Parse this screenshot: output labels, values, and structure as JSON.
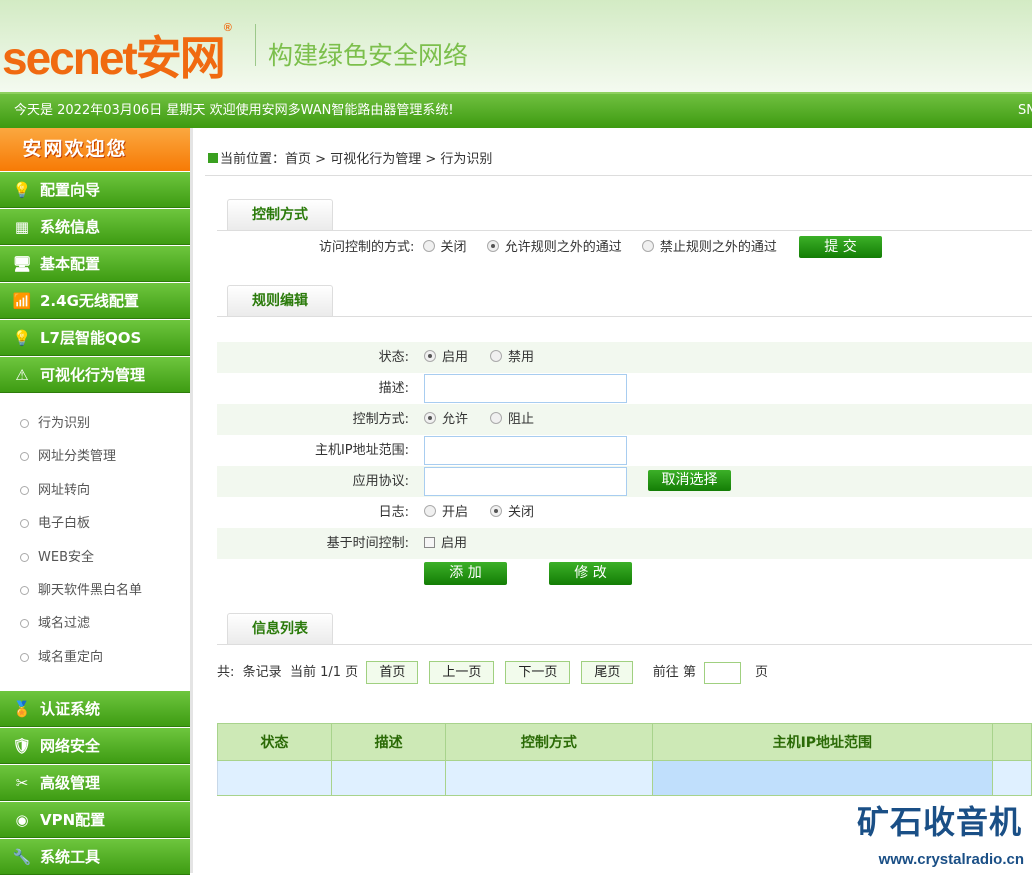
{
  "header": {
    "logo": "secnet安网",
    "registered": "®",
    "slogan": "构建绿色安全网络"
  },
  "topbar": {
    "welcome": "今天是 2022年03月06日 星期天 欢迎使用安网多WAN智能路由器管理系统!",
    "sn": "SN"
  },
  "sidebar": {
    "welcome": "安网欢迎您",
    "top_items": [
      {
        "label": "配置向导",
        "icon": "💡"
      },
      {
        "label": "系统信息",
        "icon": "▦"
      },
      {
        "label": "基本配置",
        "icon": "🖥"
      },
      {
        "label": "2.4G无线配置",
        "icon": "📶"
      },
      {
        "label": "L7层智能QOS",
        "icon": "💡"
      },
      {
        "label": "可视化行为管理",
        "icon": "⚠"
      }
    ],
    "sub_items": [
      "行为识别",
      "网址分类管理",
      "网址转向",
      "电子白板",
      "WEB安全",
      "聊天软件黑白名单",
      "域名过滤",
      "域名重定向"
    ],
    "bottom_items": [
      {
        "label": "认证系统",
        "icon": "🏅"
      },
      {
        "label": "网络安全",
        "icon": "🛡"
      },
      {
        "label": "高级管理",
        "icon": "✂"
      },
      {
        "label": "VPN配置",
        "icon": "◉"
      },
      {
        "label": "系统工具",
        "icon": "🔧"
      }
    ]
  },
  "breadcrumb": {
    "prefix": "当前位置：",
    "home": "首页",
    "sep": ">",
    "section": "可视化行为管理",
    "page": "行为识别"
  },
  "control": {
    "tab": "控制方式",
    "label": "访问控制的方式:",
    "options": [
      "关闭",
      "允许规则之外的通过",
      "禁止规则之外的通过"
    ],
    "selected": 1,
    "submit": "提  交"
  },
  "rules": {
    "tab": "规则编辑",
    "status_label": "状态:",
    "status_options": [
      "启用",
      "禁用"
    ],
    "desc_label": "描述:",
    "desc_value": "",
    "mode_label": "控制方式:",
    "mode_options": [
      "允许",
      "阻止"
    ],
    "ip_label": "主机IP地址范围:",
    "ip_value": "",
    "proto_label": "应用协议:",
    "proto_value": "",
    "cancel_select": "取消选择",
    "log_label": "日志:",
    "log_options": [
      "开启",
      "关闭"
    ],
    "time_label": "基于时间控制:",
    "time_option": "启用",
    "add": "添  加",
    "modify": "修  改"
  },
  "list": {
    "tab": "信息列表",
    "total": "共:",
    "records": "条记录",
    "current": "当前",
    "page_info": "1/1",
    "page": "页",
    "first": "首页",
    "prev": "上一页",
    "next": "下一页",
    "last": "尾页",
    "goto": "前往",
    "nth": "第",
    "goto_value": "",
    "columns": [
      "状态",
      "描述",
      "控制方式",
      "主机IP地址范围"
    ]
  },
  "watermark": {
    "title": "矿石收音机",
    "url": "www.crystalradio.cn"
  }
}
